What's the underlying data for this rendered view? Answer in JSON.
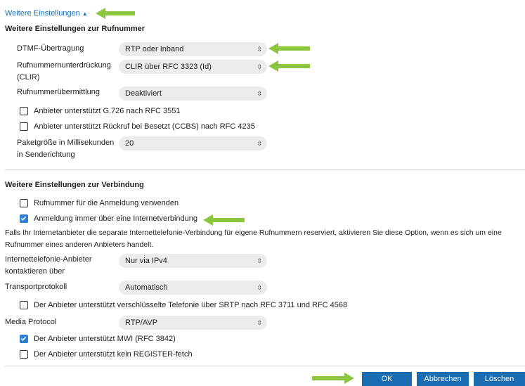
{
  "colors": {
    "accent": "#1a6db3",
    "checkbox_on": "#2b7fd4",
    "arrow": "#8cc63f",
    "select_bg": "#ececec"
  },
  "toggle": {
    "label": "Weitere Einstellungen"
  },
  "section1": {
    "heading": "Weitere Einstellungen zur Rufnummer",
    "dtmf": {
      "label": "DTMF-Übertragung",
      "value": "RTP oder Inband"
    },
    "clir": {
      "label_line1": "Rufnummernunterdrückung",
      "label_line2": "(CLIR)",
      "value": "CLIR über RFC 3323 (Id)"
    },
    "clip": {
      "label": "Rufnummerübermittlung",
      "value": "Deaktiviert"
    },
    "g726": {
      "label": "Anbieter unterstützt G.726 nach RFC 3551",
      "checked": false
    },
    "ccbs": {
      "label": "Anbieter unterstützt Rückruf bei Besetzt (CCBS) nach RFC 4235",
      "checked": false
    },
    "packet": {
      "label_line1": "Paketgröße in Millisekunden",
      "label_line2": "in Senderichtung",
      "value": "20"
    }
  },
  "section2": {
    "heading": "Weitere Einstellungen zur Verbindung",
    "use_number": {
      "label": "Rufnummer für die Anmeldung verwenden",
      "checked": false
    },
    "always_internet": {
      "label": "Anmeldung immer über eine Internetverbindung",
      "checked": true
    },
    "info_line1": "Falls Ihr Internetanbieter die separate Internettelefonie-Verbindung für eigene Rufnummern reserviert, aktivieren Sie diese Option, wenn es sich um eine",
    "info_line2": "Rufnummer eines anderen Anbieters handelt.",
    "contact": {
      "label_line1": "Internettelefonie-Anbieter",
      "label_line2": "kontaktieren über",
      "value": "Nur via IPv4"
    },
    "transport": {
      "label": "Transportprotokoll",
      "value": "Automatisch"
    },
    "srtp": {
      "label": "Der Anbieter unterstützt verschlüsselte Telefonie über SRTP nach RFC 3711 und RFC 4568",
      "checked": false
    },
    "media": {
      "label": "Media Protocol",
      "value": "RTP/AVP"
    },
    "mwi": {
      "label": "Der Anbieter unterstützt MWI (RFC 3842)",
      "checked": true
    },
    "register": {
      "label": "Der Anbieter unterstützt kein REGISTER-fetch",
      "checked": false
    }
  },
  "buttons": {
    "ok": "OK",
    "cancel": "Abbrechen",
    "delete": "Löschen"
  }
}
